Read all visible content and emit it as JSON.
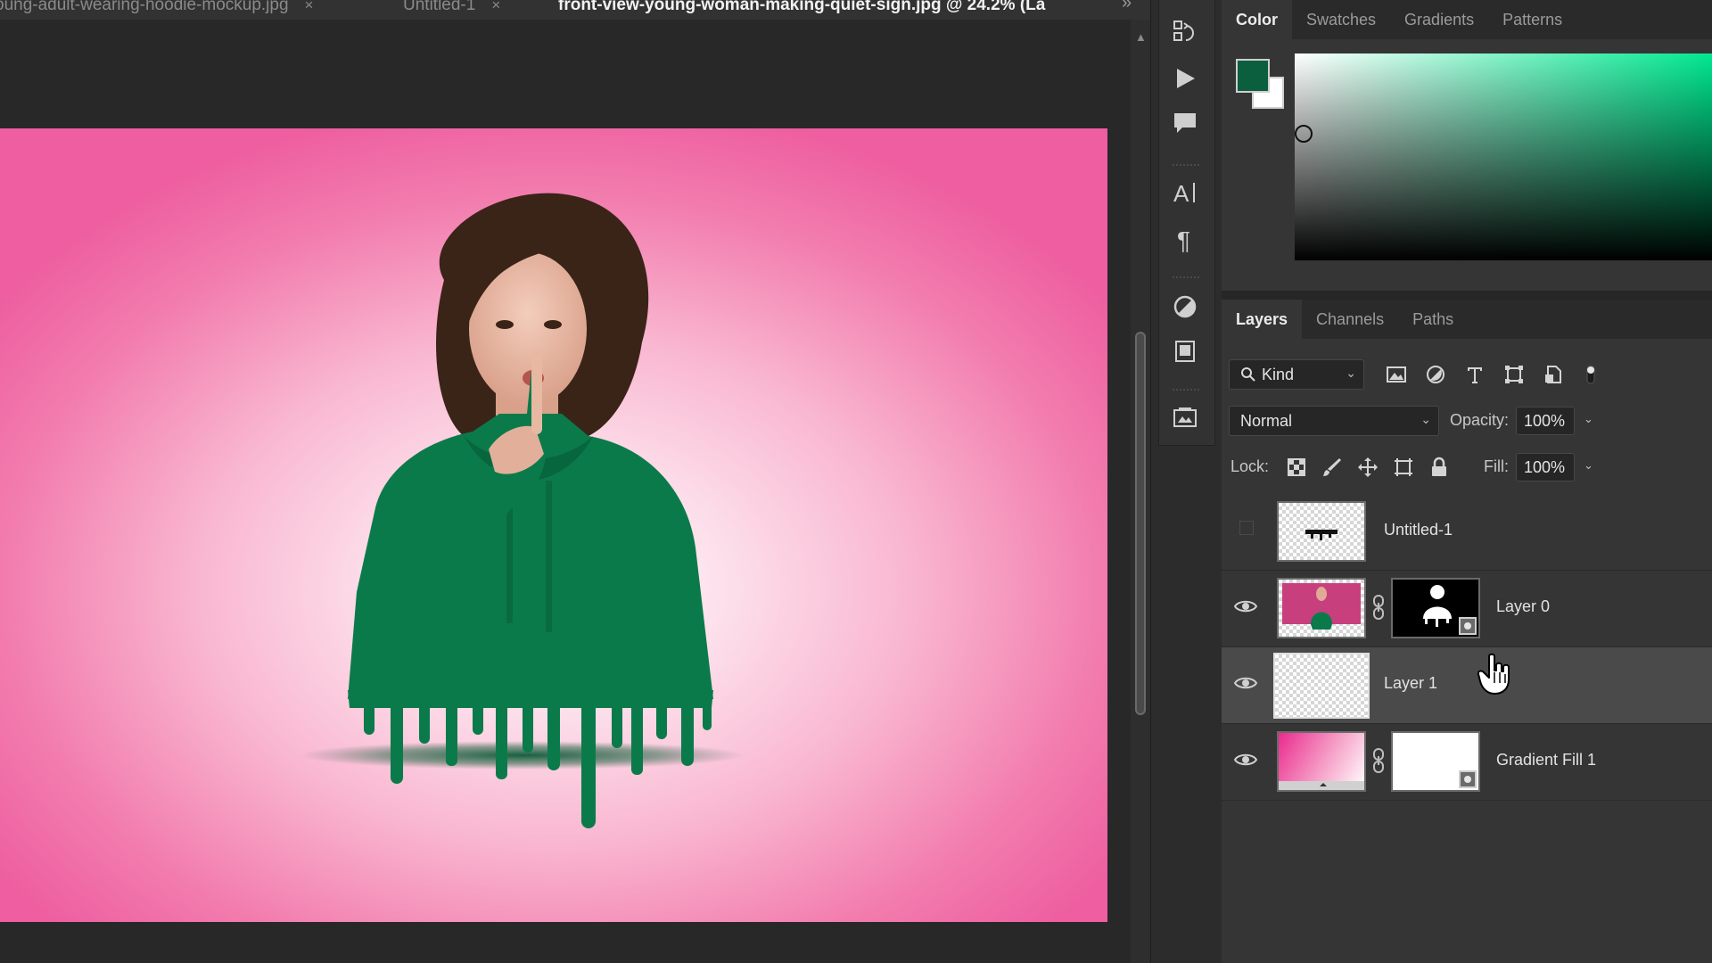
{
  "document_tabs": [
    {
      "label": "oung-adult-wearing-hoodie-mockup.jpg",
      "close": "×",
      "active": false
    },
    {
      "label": "Untitled-1",
      "close": "×",
      "active": false
    },
    {
      "label": "front-view-young-woman-making-quiet-sign.jpg @ 24.2% (La",
      "active": true
    }
  ],
  "tabbar_overflow": "»",
  "color_panel": {
    "tabs": [
      "Color",
      "Swatches",
      "Gradients",
      "Patterns"
    ],
    "active_tab": "Color",
    "foreground_color": "#0b5e3e",
    "background_color": "#ffffff",
    "spectrum_hue": "#00e890"
  },
  "layers_panel": {
    "tabs": [
      "Layers",
      "Channels",
      "Paths"
    ],
    "active_tab": "Layers",
    "filter": {
      "value": "Kind"
    },
    "blend_mode": "Normal",
    "opacity_label": "Opacity:",
    "opacity_value": "100%",
    "lock_label": "Lock:",
    "fill_label": "Fill:",
    "fill_value": "100%",
    "layers": [
      {
        "name": "Untitled-1",
        "visible": false,
        "selected": false,
        "thumb": "checker-drip",
        "mask": false
      },
      {
        "name": "Layer 0",
        "visible": true,
        "selected": false,
        "thumb": "photo",
        "mask": true
      },
      {
        "name": "Layer 1",
        "visible": true,
        "selected": true,
        "thumb": "checker",
        "mask": false
      },
      {
        "name": "Gradient Fill 1",
        "visible": true,
        "selected": false,
        "thumb": "gradient",
        "mask": true
      }
    ]
  },
  "tools": [
    "history-icon",
    "play-icon",
    "comment-icon",
    "character-icon",
    "paragraph-icon",
    "adjustments-icon",
    "libraries-icon",
    "properties-icon"
  ],
  "canvas": {
    "background_gradient_center": "#ffffff",
    "background_gradient_edge": "#ee5ea0",
    "hoodie_color": "#0b7a4a"
  }
}
